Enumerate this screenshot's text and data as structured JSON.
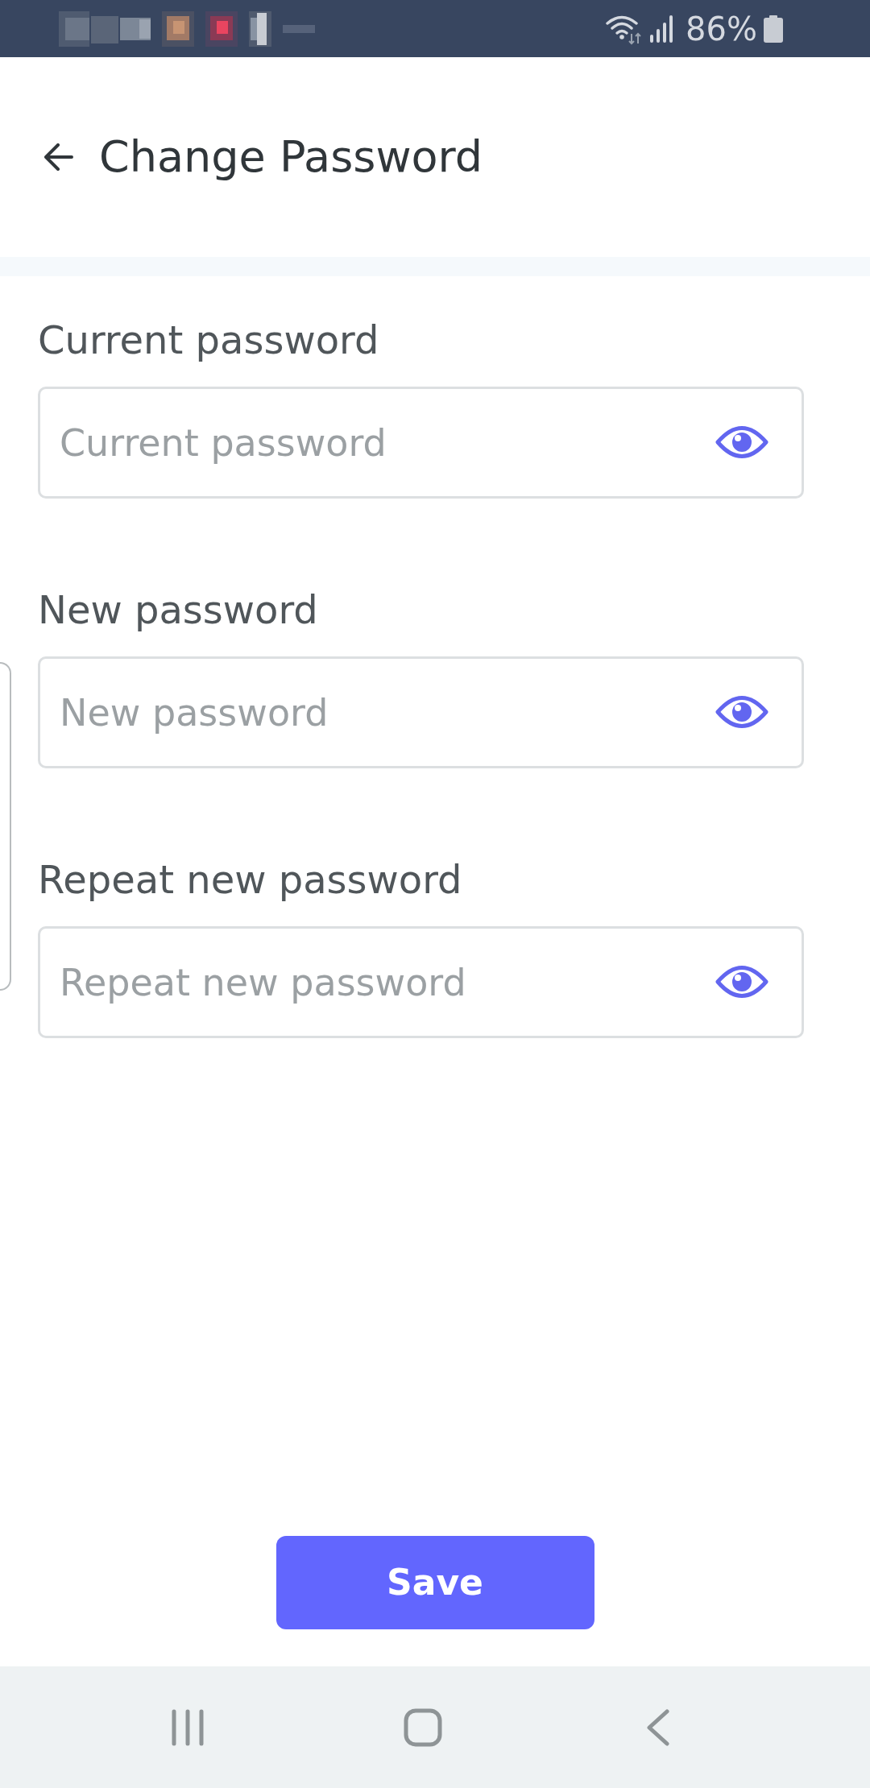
{
  "status_bar": {
    "battery": "86%"
  },
  "header": {
    "title": "Change Password"
  },
  "fields": [
    {
      "label": "Current password",
      "placeholder": "Current password"
    },
    {
      "label": "New password",
      "placeholder": "New password"
    },
    {
      "label": "Repeat new password",
      "placeholder": "Repeat new password"
    }
  ],
  "save_button": {
    "label": "Save"
  }
}
